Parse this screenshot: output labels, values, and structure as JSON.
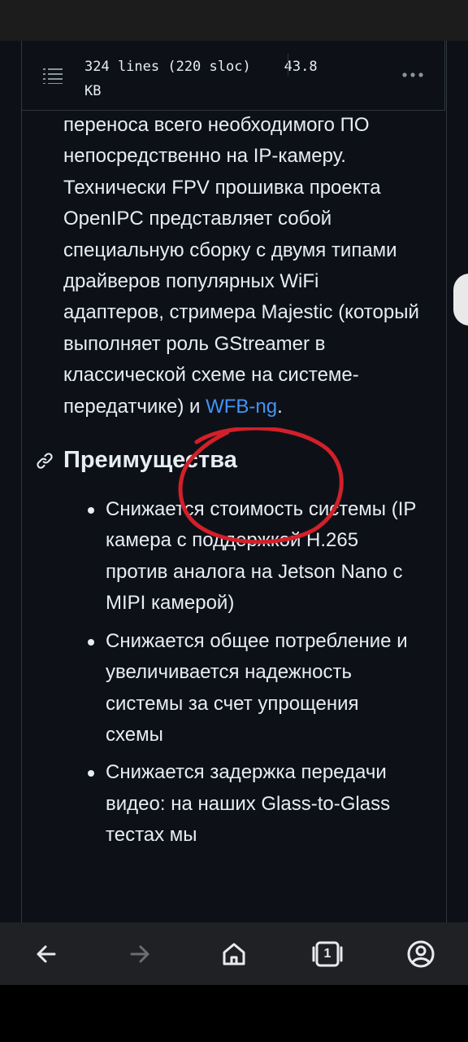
{
  "file_header": {
    "size_info": "324 lines (220 sloc)",
    "size_kb": "43.8",
    "size_unit": "KB",
    "menu_icon": "list-icon",
    "more_icon": "kebab-horizontal-icon"
  },
  "article": {
    "paragraph": {
      "text_before_link": "переноса всего необходимого ПО непосредственно на IP-камеру. Технически FPV прошивка проекта OpenIPC представляет собой специальную сборку с двумя типами драйверов популярных WiFi адаптеров, стримера Majestic (который выполняет роль GStreamer в классической схеме на системе-передатчике) и ",
      "link_text": "WFB-ng",
      "text_after_link": "."
    },
    "heading": {
      "text": "Преимущества",
      "anchor_icon": "link-icon"
    },
    "list_items": [
      "Снижается стоимость системы (IP камера с поддержкой H.265 против аналога на Jetson Nano с MIPI камерой)",
      "Снижается общее потребление и увеличивается надежность системы за счет упрощения схемы",
      "Снижается задержка передачи видео: на наших Glass-to-Glass тестах мы"
    ]
  },
  "annotation": {
    "color": "#d2202a",
    "shape": "hand-drawn-circle"
  },
  "navbar": {
    "buttons": [
      {
        "icon": "back-arrow-icon",
        "enabled": true
      },
      {
        "icon": "forward-arrow-icon",
        "enabled": false
      },
      {
        "icon": "home-icon",
        "enabled": true
      },
      {
        "icon": "tabs-icon",
        "tab_count": "1",
        "enabled": true
      },
      {
        "icon": "account-icon",
        "enabled": true
      }
    ]
  },
  "colors": {
    "background": "#0d1117",
    "text": "#e6edf3",
    "link": "#4493f8",
    "border": "#30363d",
    "navbar": "#1f2124"
  }
}
